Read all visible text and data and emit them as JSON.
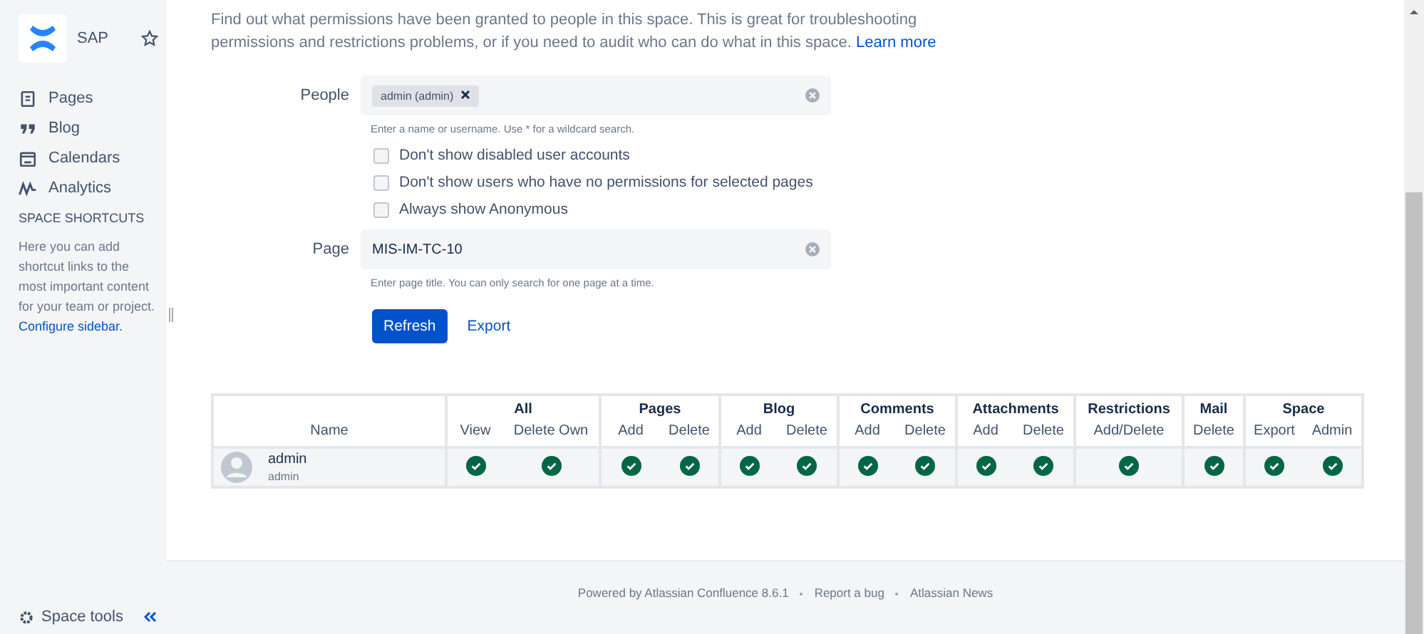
{
  "sidebar": {
    "space_name": "SAP",
    "items": [
      {
        "label": "Pages"
      },
      {
        "label": "Blog"
      },
      {
        "label": "Calendars"
      },
      {
        "label": "Analytics"
      }
    ],
    "shortcuts_heading": "SPACE SHORTCUTS",
    "shortcuts_text": "Here you can add shortcut links to the most important content for your team or project.",
    "configure_link": "Configure sidebar.",
    "space_tools": "Space tools"
  },
  "intro": {
    "text": "Find out what permissions have been granted to people in this space. This is great for troubleshooting permissions and restrictions problems, or if you need to audit who can do what in this space.",
    "link": "Learn more"
  },
  "form": {
    "people_label": "People",
    "people_token": "admin (admin)",
    "people_hint": "Enter a name or username. Use * for a wildcard search.",
    "checkboxes": [
      {
        "label": "Don't show disabled user accounts",
        "checked": false
      },
      {
        "label": "Don't show users who have no permissions for selected pages",
        "checked": false
      },
      {
        "label": "Always show Anonymous",
        "checked": false
      }
    ],
    "page_label": "Page",
    "page_value": "MIS-IM-TC-10",
    "page_hint": "Enter page title. You can only search for one page at a time.",
    "refresh": "Refresh",
    "export": "Export"
  },
  "table": {
    "name_header": "Name",
    "groups": [
      {
        "label": "All",
        "columns": [
          "View",
          "Delete Own"
        ]
      },
      {
        "label": "Pages",
        "columns": [
          "Add",
          "Delete"
        ]
      },
      {
        "label": "Blog",
        "columns": [
          "Add",
          "Delete"
        ]
      },
      {
        "label": "Comments",
        "columns": [
          "Add",
          "Delete"
        ]
      },
      {
        "label": "Attachments",
        "columns": [
          "Add",
          "Delete"
        ]
      },
      {
        "label": "Restrictions",
        "columns": [
          "Add/Delete"
        ]
      },
      {
        "label": "Mail",
        "columns": [
          "Delete"
        ]
      },
      {
        "label": "Space",
        "columns": [
          "Export",
          "Admin"
        ]
      }
    ],
    "rows": [
      {
        "name": "admin",
        "username": "admin",
        "permissions": [
          true,
          true,
          true,
          true,
          true,
          true,
          true,
          true,
          true,
          true,
          true,
          true,
          true,
          true
        ]
      }
    ]
  },
  "footer": {
    "items": [
      "Powered by Atlassian Confluence 8.6.1",
      "Report a bug",
      "Atlassian News"
    ]
  }
}
